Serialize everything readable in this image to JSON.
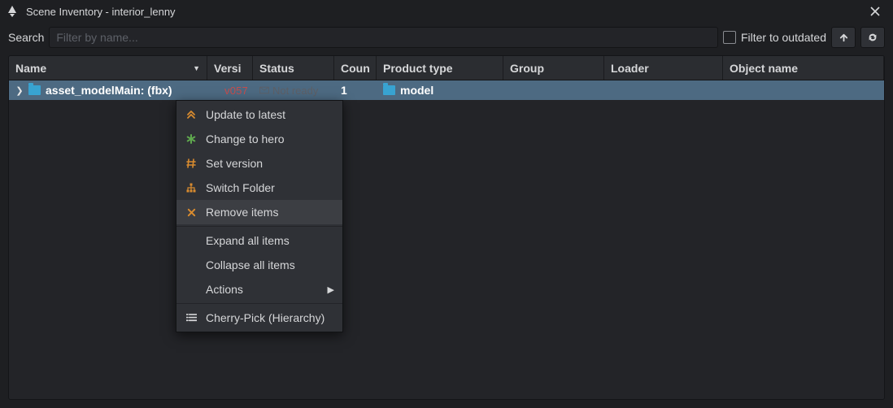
{
  "window": {
    "title": "Scene Inventory - interior_lenny"
  },
  "toolbar": {
    "search_label": "Search",
    "search_placeholder": "Filter by name...",
    "filter_outdated_label": "Filter to outdated"
  },
  "columns": {
    "name": "Name",
    "version": "Versi",
    "status": "Status",
    "count": "Coun",
    "product_type": "Product type",
    "group": "Group",
    "loader": "Loader",
    "object_name": "Object name"
  },
  "rows": [
    {
      "name": "asset_modelMain: (fbx)",
      "version": "v057",
      "status": "Not ready",
      "count": "1",
      "product_type": "model",
      "group": "",
      "loader": "",
      "object_name": ""
    }
  ],
  "context_menu": {
    "items": [
      {
        "label": "Update to latest",
        "icon": "double-chevron-up",
        "color": "#d88b2f"
      },
      {
        "label": "Change to hero",
        "icon": "asterisk",
        "color": "#5fa84e"
      },
      {
        "label": "Set version",
        "icon": "hash",
        "color": "#d88b2f"
      },
      {
        "label": "Switch Folder",
        "icon": "sitemap",
        "color": "#d88b2f"
      },
      {
        "label": "Remove items",
        "icon": "x",
        "color": "#d88b2f",
        "hover": true
      },
      {
        "sep": true
      },
      {
        "label": "Expand all items"
      },
      {
        "label": "Collapse all items"
      },
      {
        "label": "Actions",
        "submenu": true
      },
      {
        "sep": true
      },
      {
        "label": "Cherry-Pick (Hierarchy)",
        "icon": "list"
      }
    ]
  }
}
